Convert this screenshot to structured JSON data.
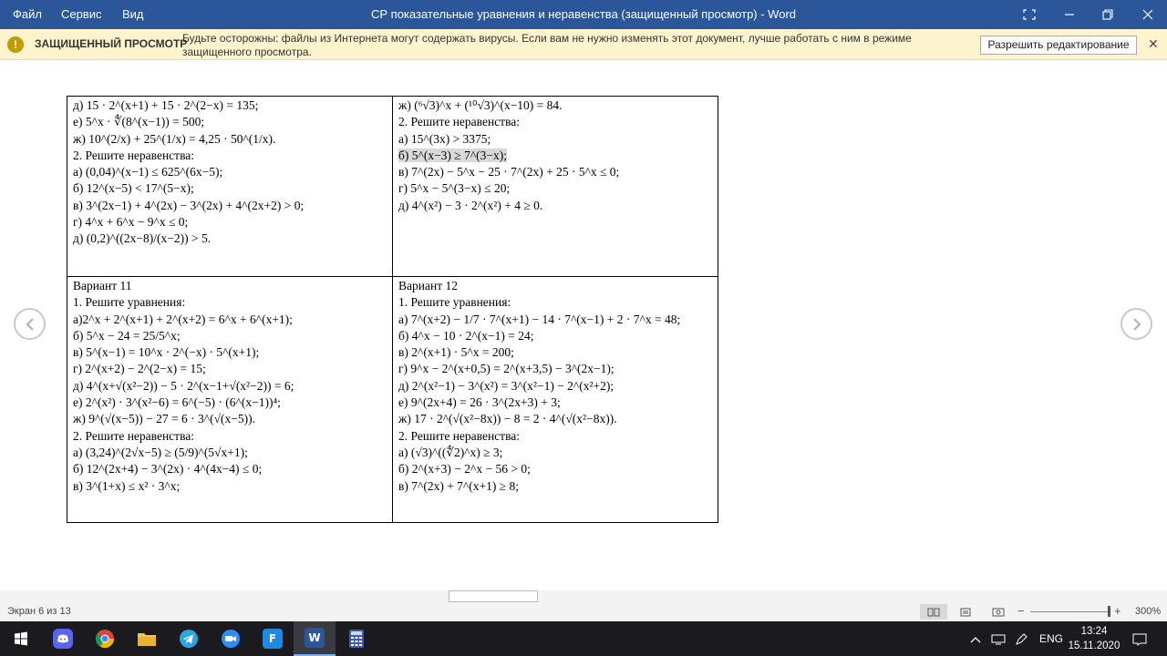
{
  "titlebar": {
    "menu": [
      "Файл",
      "Сервис",
      "Вид"
    ],
    "title": "СР показательные уравнения и неравенства (защищенный просмотр) - Word",
    "colors": {
      "bar": "#2b579a"
    }
  },
  "protected_view": {
    "title": "ЗАЩИЩЕННЫЙ ПРОСМОТР",
    "message": "Будьте осторожны: файлы из Интернета могут содержать вирусы. Если вам не нужно изменять этот документ, лучше работать с ним в режиме защищенного просмотра.",
    "button": "Разрешить редактирование",
    "icon": "shield-icon",
    "close_glyph": "✕"
  },
  "document": {
    "cell_tl": [
      "д) 15 · 2^(x+1) + 15 · 2^(2−x) = 135;",
      "е) 5^x · ∜(8^(x−1)) = 500;",
      "ж) 10^(2/x) + 25^(1/x) = 4,25 · 50^(1/x).",
      "2. Решите неравенства:",
      "а) (0,04)^(x−1) ≤ 625^(6x−5);",
      "б) 12^(x−5) < 17^(5−x);",
      "в) 3^(2x−1) + 4^(2x) − 3^(2x) + 4^(2x+2) > 0;",
      "г) 4^x + 6^x − 9^x ≤ 0;",
      "д) (0,2)^((2x−8)/(x−2)) > 5."
    ],
    "cell_tr": [
      "ж) (⁶√3)^x + (¹⁰√3)^(x−10) = 84.",
      "2. Решите неравенства:",
      "а) 15^(3x) > 3375;",
      "б) 5^(x−3) ≥ 7^(3−x);",
      "в) 7^(2x) − 5^x − 25 · 7^(2x) + 25 · 5^x ≤ 0;",
      "г) 5^x − 5^(3−x) ≤ 20;",
      "д) 4^(x²) − 3 · 2^(x²) + 4 ≥ 0."
    ],
    "cell_bl": [
      "Вариант 11",
      "1. Решите уравнения:",
      "а)2^x + 2^(x+1) + 2^(x+2) = 6^x + 6^(x+1);",
      "б) 5^x − 24 = 25/5^x;",
      "в) 5^(x−1) = 10^x · 2^(−x) · 5^(x+1);",
      "г) 2^(x+2) − 2^(2−x) = 15;",
      "д) 4^(x+√(x²−2)) − 5 · 2^(x−1+√(x²−2)) = 6;",
      "е) 2^(x²) · 3^(x²−6) = 6^(−5) · (6^(x−1))⁴;",
      "ж) 9^(√(x−5)) − 27 = 6 · 3^(√(x−5)).",
      "2. Решите неравенства:",
      "а) (3,24)^(2√x−5) ≥ (5/9)^(5√x+1);",
      "б) 12^(2x+4) − 3^(2x) · 4^(4x−4) ≤ 0;",
      "в) 3^(1+x) ≤ x² · 3^x;"
    ],
    "cell_br": [
      "Вариант 12",
      "1. Решите уравнения:",
      "а) 7^(x+2) − 1/7 · 7^(x+1) − 14 · 7^(x−1) + 2 · 7^x = 48;",
      "б) 4^x − 10 · 2^(x−1) = 24;",
      "в) 2^(x+1) · 5^x = 200;",
      "г) 9^x − 2^(x+0,5) = 2^(x+3,5) − 3^(2x−1);",
      "д) 2^(x²−1) − 3^(x²) = 3^(x²−1) − 2^(x²+2);",
      "е) 9^(2x+4) = 26 · 3^(2x+3) + 3;",
      "ж) 17 · 2^(√(x²−8x)) − 8 = 2 · 4^(√(x²−8x)).",
      "2. Решите неравенства:",
      "а) (√3)^((∜2)^x) ≥ 3;",
      "б) 2^(x+3) − 2^x − 56 > 0;",
      "в) 7^(2x) + 7^(x+1) ≥ 8;"
    ]
  },
  "status": {
    "page": "Экран 6 из 13",
    "zoom": "300%",
    "zoom_fraction": 0.98
  },
  "taskbar": {
    "time": "13:24",
    "date": "15.11.2020",
    "lang": "ENG",
    "apps": [
      "windows-start",
      "discord",
      "chrome",
      "file-explorer",
      "telegram",
      "zoom",
      "f-app",
      "word",
      "calculator"
    ]
  }
}
